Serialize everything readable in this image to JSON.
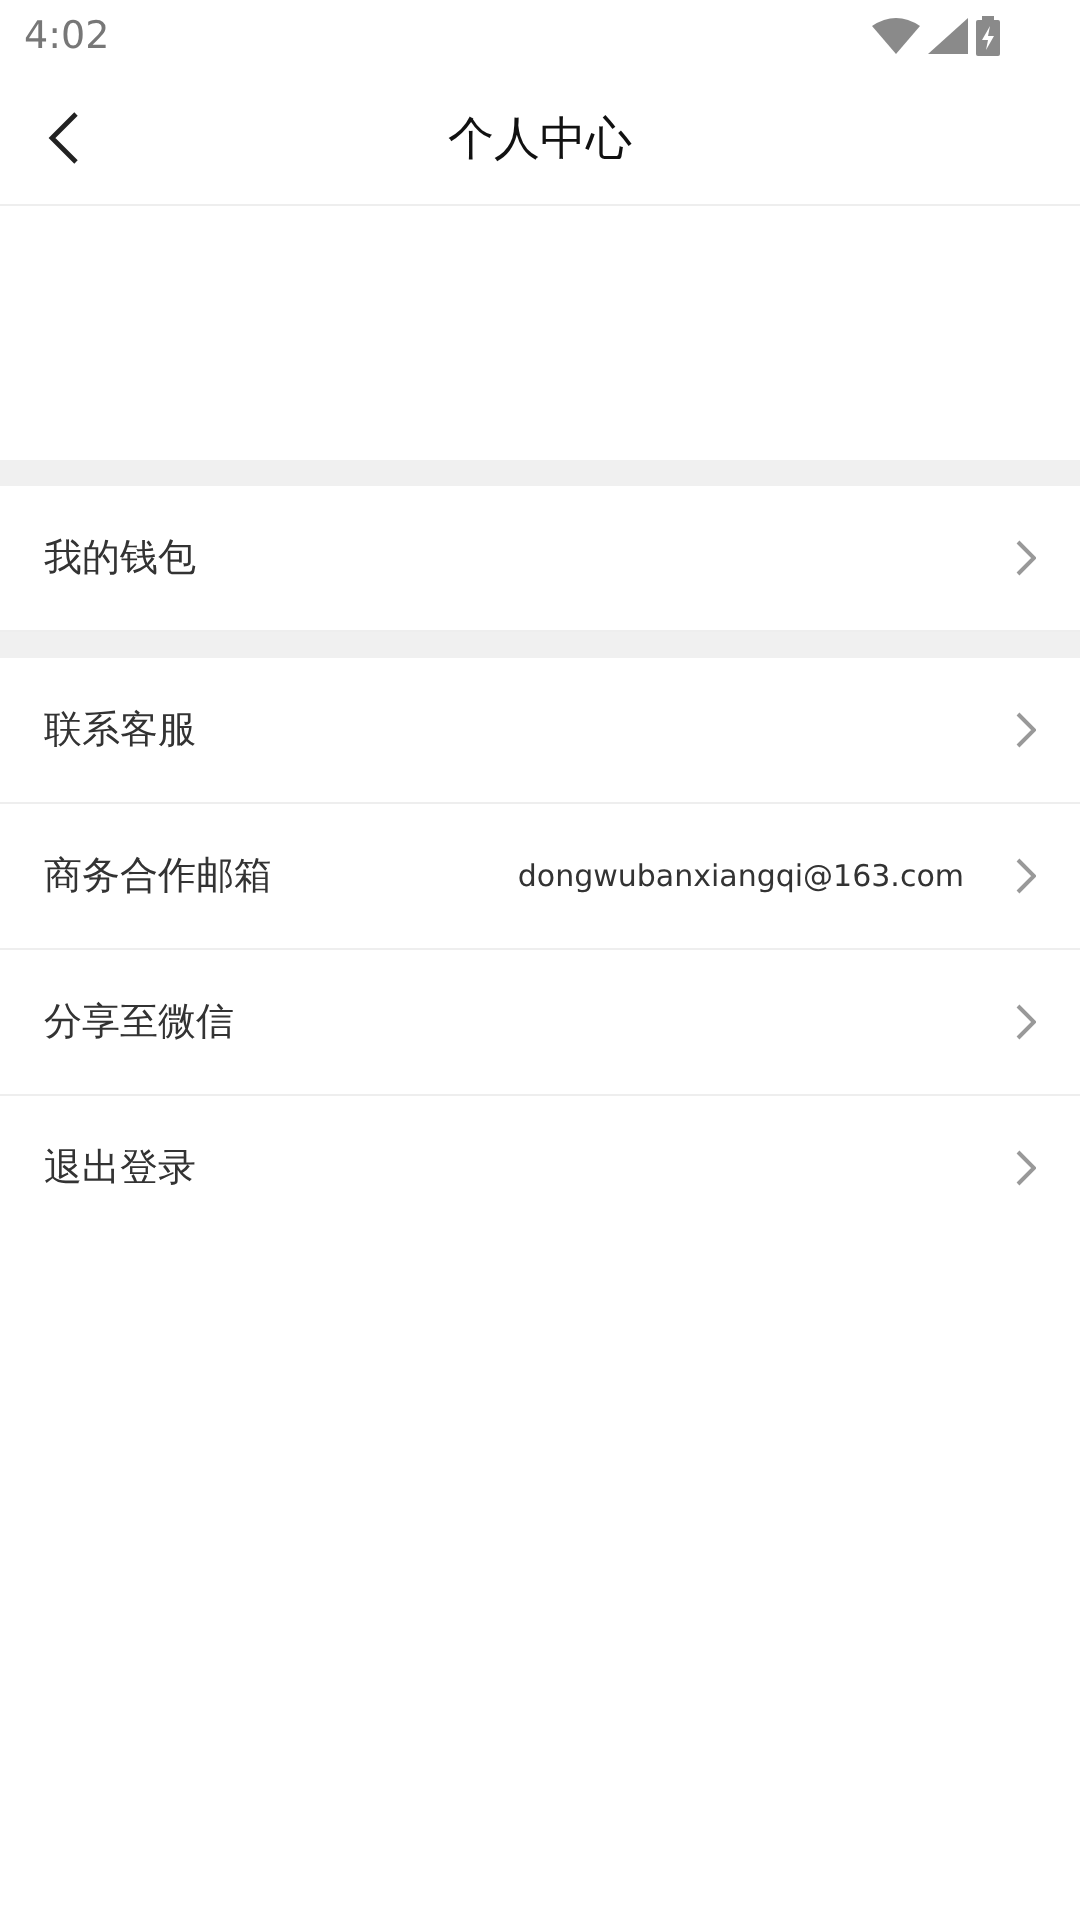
{
  "status_bar": {
    "time": "4:02"
  },
  "header": {
    "title": "个人中心"
  },
  "groups": [
    {
      "items": [
        {
          "label": "我的钱包"
        }
      ]
    },
    {
      "items": [
        {
          "label": "联系客服"
        },
        {
          "label": "商务合作邮箱",
          "value": "dongwubanxiangqi@163.com"
        },
        {
          "label": "分享至微信"
        },
        {
          "label": "退出登录"
        }
      ]
    }
  ]
}
